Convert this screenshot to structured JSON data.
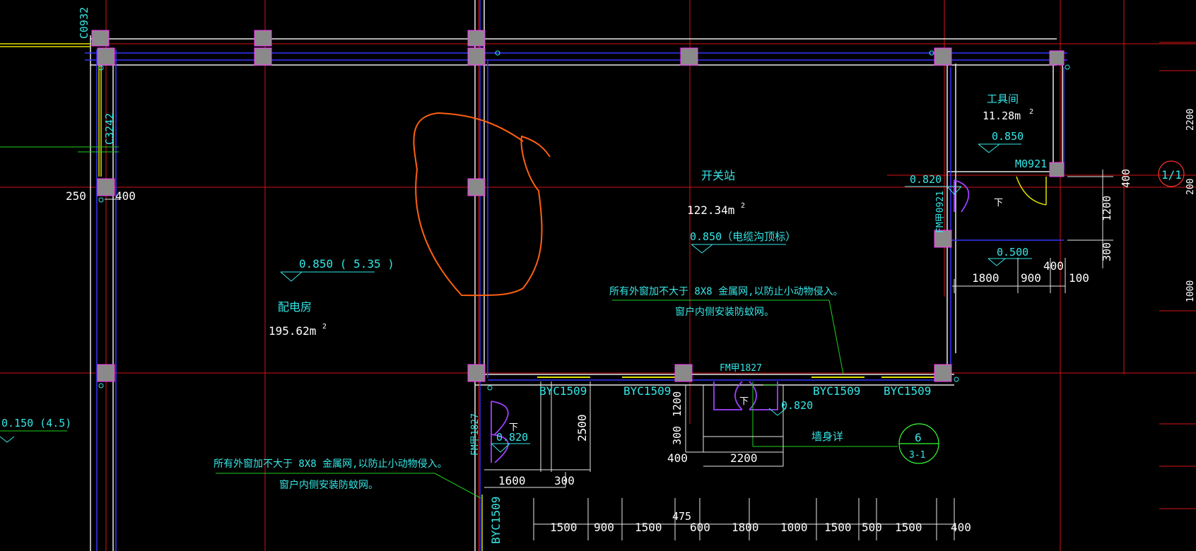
{
  "rooms": {
    "switch_station": {
      "name": "开关站",
      "area": "122.34m",
      "sup": "2",
      "elevation": "0.850（电缆沟顶标）"
    },
    "distribution_room": {
      "name": "配电房",
      "area": "195.62m",
      "sup": "2",
      "elevation": "0.850 ( 5.35 )"
    },
    "tool_room": {
      "name": "工具间",
      "area": "11.28m",
      "sup": "2",
      "elevation": "0.850"
    }
  },
  "notes": {
    "note1_line1": "所有外窗加不大于    8X8 金属网,以防止小动物侵入。",
    "note1_line2": "窗户内侧安装防蚊网。",
    "note2_line1": "所有外窗加不大于    8X8 金属网,以防止小动物侵入。",
    "note2_line2": "窗户内侧安装防蚊网。"
  },
  "doors_windows": {
    "w1": "BYC1509",
    "w2": "BYC1509",
    "w3": "BYC1509",
    "w4": "BYC1509",
    "w5": "BYC1509",
    "d_fm1827_h": "FM甲1827",
    "d_fm1827_v": "FM甲1827",
    "d_fm0921": "FM甲0921",
    "d_m0921": "M0921",
    "left_top_window": "C0932",
    "left_mid_window": "C3242"
  },
  "elevations": {
    "e_0820_a": "0.820",
    "e_0820_b": "0.820",
    "e_0820_c": "0.820",
    "e_0500": "0.500",
    "e_0150": "0.150  (4.5)",
    "down_1": "下",
    "down_2": "下",
    "down_3": "下"
  },
  "dimensions": {
    "d250": "250",
    "d400_left": "400",
    "bottom_chain": [
      "1500",
      "900",
      "1500",
      "600",
      "1800",
      "1000",
      "1500",
      "500",
      "1500",
      "400"
    ],
    "d475": "475",
    "d1600": "1600",
    "d300_a": "300",
    "d2500": "2500",
    "d1200_a": "1200",
    "d300_b": "300",
    "d400_b": "400",
    "d2200": "2200",
    "right_chain": [
      "1800",
      "900",
      "100"
    ],
    "d400_c": "400",
    "d1200_b": "1200",
    "d300_c": "300",
    "d400_d": "400",
    "d200": "200",
    "d2200_edge": "2200",
    "d1000_edge": "1000"
  },
  "detail": {
    "label": "墙身详",
    "num": "6",
    "sheet": "3-1"
  },
  "axis_bubble": "1/1"
}
